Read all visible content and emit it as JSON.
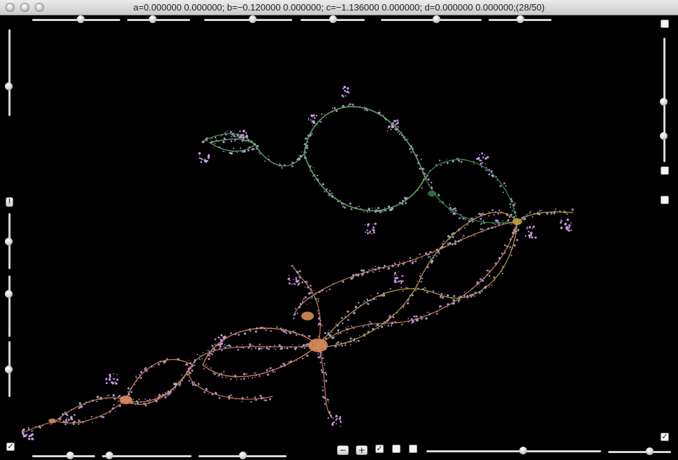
{
  "window": {
    "title": "a=0.000000 0.000000; b=−0.120000 0.000000; c=−1.136000 0.000000; d=0.000000 0.000000;(28/50)"
  },
  "controls": {
    "top_sliders": [
      0.55,
      0.4,
      0.55,
      0.5,
      0.55,
      0.5
    ],
    "bottom_sliders": [
      0.6,
      0.08,
      0.5,
      0.55,
      0.65
    ],
    "left_sliders": [
      0.65,
      0.5,
      0.3,
      0.5
    ],
    "right_sliders": [
      0.7,
      0.45
    ],
    "bottom_left_check": "✓",
    "bottom_right_check": "✓",
    "minus_label": "−",
    "plus_label": "+",
    "bottom_checks": [
      "✓",
      "",
      ""
    ],
    "right_top_check": "",
    "right_mid_check": "",
    "right_lower_check": "",
    "left_button_label": "!"
  },
  "colors": {
    "upper_curve": "#5aa860",
    "upper_curve_dark": "#2f7a3c",
    "lower_curve": "#d98a5a",
    "lower_curve_yellow": "#b9a03c",
    "fringe": "#c89ce6",
    "fringe_alt": "#9ed0e8"
  }
}
